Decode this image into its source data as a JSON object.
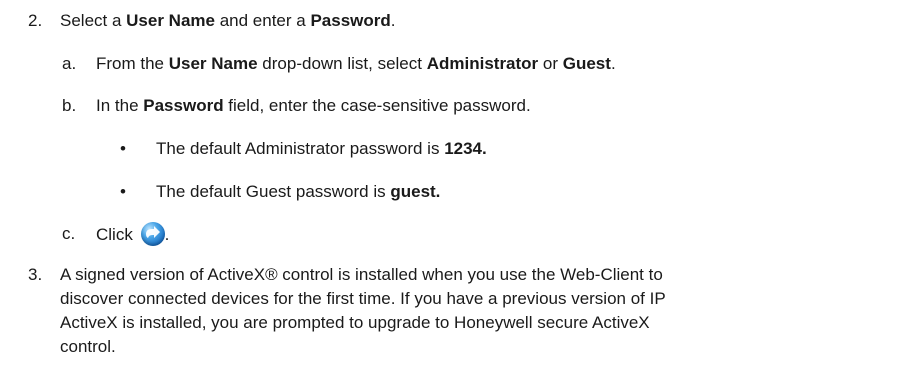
{
  "steps": {
    "step2": {
      "number": "2.",
      "t1": "Select a ",
      "b1": "User Name",
      "t2": " and enter a ",
      "b2": "Password",
      "t3": "."
    },
    "a": {
      "letter": "a.",
      "t1": "From the ",
      "b1": "User Name",
      "t2": " drop-down list, select ",
      "b2": "Administrator",
      "t3": " or ",
      "b3": "Guest",
      "t4": "."
    },
    "b": {
      "letter": "b.",
      "t1": "In the ",
      "b1": "Password",
      "t2": " field, enter the case-sensitive password."
    },
    "bullets": [
      {
        "symbol": "•",
        "text": "The default Administrator password is ",
        "bold": "1234."
      },
      {
        "symbol": "•",
        "text": "The default Guest password is ",
        "bold": "guest."
      }
    ],
    "c": {
      "letter": "c.",
      "t1": "Click ",
      "icon": "go-arrow-icon",
      "t2": "."
    },
    "step3": {
      "number": "3.",
      "lines": [
        "A signed version of ActiveX® control is installed when you use the Web-Client to",
        "discover connected devices for the first time. If you have a previous version of IP",
        "ActiveX is installed, you are prompted to upgrade to Honeywell secure ActiveX",
        "control."
      ]
    }
  }
}
